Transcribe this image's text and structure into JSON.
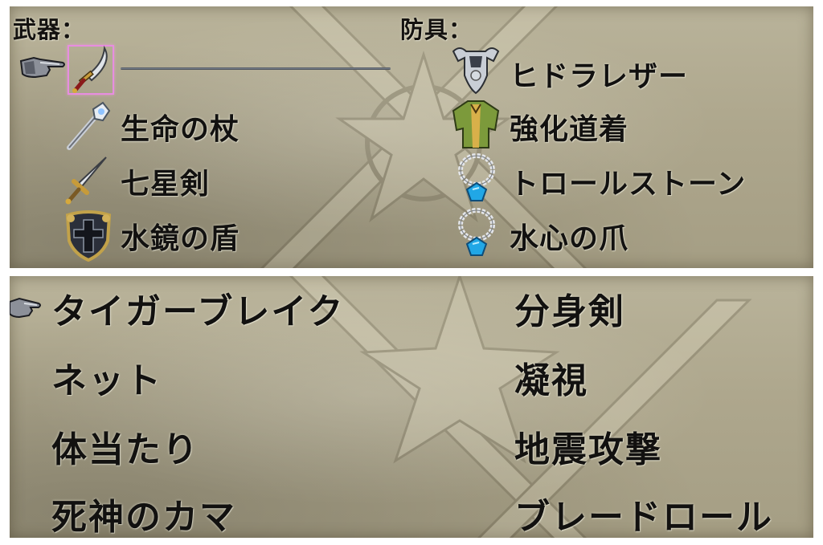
{
  "equipment": {
    "weapon_heading": "武器：",
    "armor_heading": "防具：",
    "weapons": [
      {
        "label": "",
        "icon": "scimitar-icon",
        "selected": true
      },
      {
        "label": "生命の杖",
        "icon": "staff-icon"
      },
      {
        "label": "七星剣",
        "icon": "sword-icon"
      },
      {
        "label": "水鏡の盾",
        "icon": "shield-icon"
      }
    ],
    "armor": [
      {
        "label": "ヒドラレザー",
        "icon": "armor-icon"
      },
      {
        "label": "強化道着",
        "icon": "robe-icon"
      },
      {
        "label": "トロールストーン",
        "icon": "necklace-icon"
      },
      {
        "label": "水心の爪",
        "icon": "necklace-icon"
      }
    ]
  },
  "skills": {
    "left": [
      "タイガーブレイク",
      "ネット",
      "体当たり",
      "死神のカマ"
    ],
    "right": [
      "分身剣",
      "凝視",
      "地震攻撃",
      "ブレードロール"
    ],
    "selected": "タイガーブレイク"
  },
  "colors": {
    "panel": "#aea78d",
    "text": "#121110",
    "cursor_highlight": "#e78de0"
  }
}
